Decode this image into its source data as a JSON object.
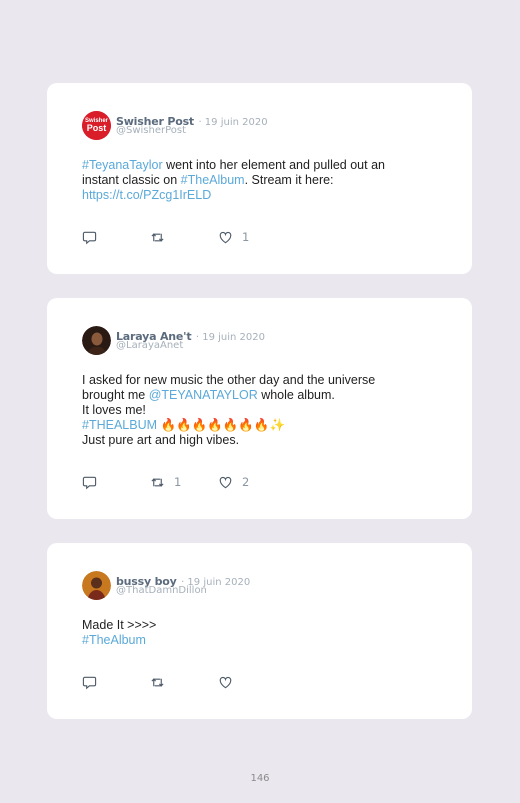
{
  "tweets": [
    {
      "avatar_label": "Swisher Post",
      "name": "Swisher Post",
      "date": "· 19 juin 2020",
      "handle": "@SwisherPost",
      "lines": [
        [
          {
            "t": "#TeyanaTaylor",
            "link": true
          },
          {
            "t": " went into her element and pulled out an"
          }
        ],
        [
          {
            "t": "instant classic on "
          },
          {
            "t": "#TheAlbum",
            "link": true
          },
          {
            "t": ". Stream it here:"
          }
        ],
        [
          {
            "t": "https://t.co/PZcg1IrELD",
            "link": true
          }
        ]
      ],
      "retweets": "",
      "likes": "1"
    },
    {
      "name": "Laraya Ane't",
      "date": "· 19 juin 2020",
      "handle": "@LarayaAnet",
      "lines": [
        [
          {
            "t": "I asked for new music the other day and the universe"
          }
        ],
        [
          {
            "t": "brought me "
          },
          {
            "t": "@TEYANATAYLOR",
            "link": true
          },
          {
            "t": " whole album."
          }
        ],
        [
          {
            "t": "It loves me!"
          }
        ],
        [
          {
            "t": "#THEALBUM",
            "link": true
          },
          {
            "t": " 🔥🔥🔥🔥🔥🔥🔥✨"
          }
        ],
        [
          {
            "t": "Just pure art and high vibes."
          }
        ]
      ],
      "retweets": "1",
      "likes": "2"
    },
    {
      "name": "bussy boy",
      "date": "· 19 juin 2020",
      "handle": "@ThatDamnDillon",
      "lines": [
        [
          {
            "t": "Made It >>>>"
          }
        ],
        [
          {
            "t": "#TheAlbum",
            "link": true
          }
        ]
      ],
      "retweets": "",
      "likes": ""
    }
  ],
  "page_number": "146",
  "icons": {
    "reply": "reply-icon",
    "retweet": "retweet-icon",
    "like": "heart-icon"
  },
  "colors": {
    "link": "#5aa9d9",
    "background": "#ebe7ee"
  }
}
